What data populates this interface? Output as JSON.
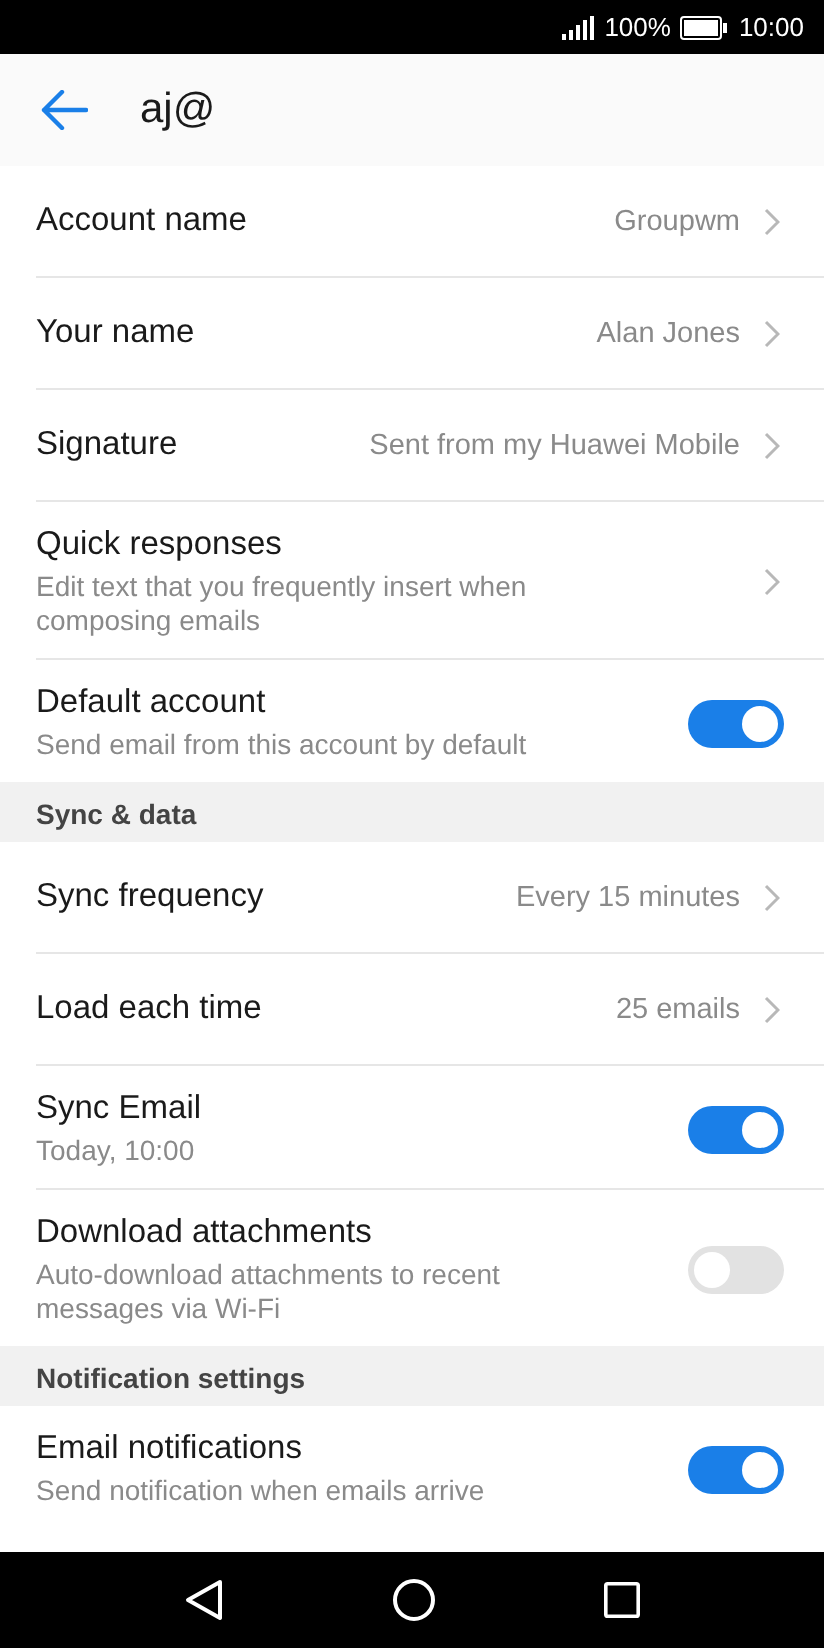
{
  "status_bar": {
    "battery": "100%",
    "time": "10:00"
  },
  "header": {
    "title": "aj@"
  },
  "sections": [
    {
      "items": [
        {
          "kind": "link",
          "title": "Account name",
          "value": "Groupwm"
        },
        {
          "kind": "link",
          "title": "Your name",
          "value": "Alan Jones"
        },
        {
          "kind": "link",
          "title": "Signature",
          "value": "Sent from my Huawei Mobile"
        },
        {
          "kind": "link",
          "title": "Quick responses",
          "subtitle": "Edit text that you frequently insert when composing emails"
        },
        {
          "kind": "toggle",
          "title": "Default account",
          "subtitle": "Send email from this account by default",
          "on": true
        }
      ]
    },
    {
      "heading": "Sync & data",
      "items": [
        {
          "kind": "link",
          "title": "Sync frequency",
          "value": "Every 15 minutes"
        },
        {
          "kind": "link",
          "title": "Load each time",
          "value": "25 emails"
        },
        {
          "kind": "toggle",
          "title": "Sync Email",
          "subtitle": "Today, 10:00",
          "on": true
        },
        {
          "kind": "toggle",
          "title": "Download attachments",
          "subtitle": "Auto-download attachments to recent messages via Wi-Fi",
          "on": false
        }
      ]
    },
    {
      "heading": "Notification settings",
      "items": [
        {
          "kind": "toggle",
          "title": "Email notifications",
          "subtitle": "Send notification when emails arrive",
          "on": true
        }
      ]
    }
  ]
}
